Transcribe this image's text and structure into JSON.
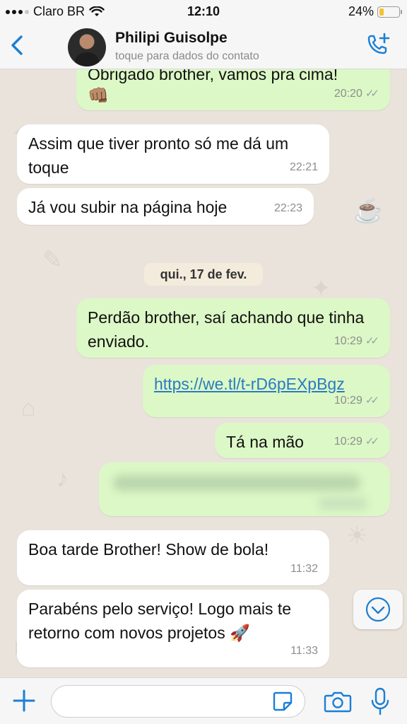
{
  "status_bar": {
    "carrier": "Claro BR",
    "time": "12:10",
    "battery_percent": "24%",
    "battery_level": 0.24
  },
  "header": {
    "contact_name": "Philipi Guisolpe",
    "contact_subtitle": "toque para dados do contato"
  },
  "messages": [
    {
      "text": "Obrigado brother, vamos pra cima!",
      "emoji": "👊🏽",
      "time": "20:20",
      "direction": "out"
    },
    {
      "text": "Assim que tiver pronto só me dá um toque",
      "time": "22:21",
      "direction": "in"
    },
    {
      "text": "Já vou subir na página hoje",
      "time": "22:23",
      "direction": "in"
    },
    {
      "text": "Perdão brother, saí achando que tinha enviado.",
      "time": "10:29",
      "direction": "out"
    },
    {
      "text": "https://we.tl/t-rD6pEXpBgz",
      "time": "10:29",
      "direction": "out"
    },
    {
      "text": "Tá na mão",
      "time": "10:29",
      "direction": "out"
    },
    {
      "text": "Boa tarde Brother! Show de bola!",
      "time": "11:32",
      "direction": "in"
    },
    {
      "text": "Parabéns pelo serviço! Logo mais te retorno com novos projetos 🚀",
      "time": "11:33",
      "direction": "in"
    }
  ],
  "date_separator": "qui., 17 de fev.",
  "icons": {
    "back": "chevron-left-icon",
    "call": "phone-plus-icon",
    "scroll": "chevron-down-icon",
    "add": "plus-icon",
    "sticker": "sticker-icon",
    "camera": "camera-icon",
    "mic": "microphone-icon"
  },
  "colors": {
    "accent": "#1a7fd6",
    "outgoing_bubble": "#dcf8c6",
    "incoming_bubble": "#ffffff",
    "chat_background": "#e9e3dc",
    "link": "#2a7bc2"
  }
}
